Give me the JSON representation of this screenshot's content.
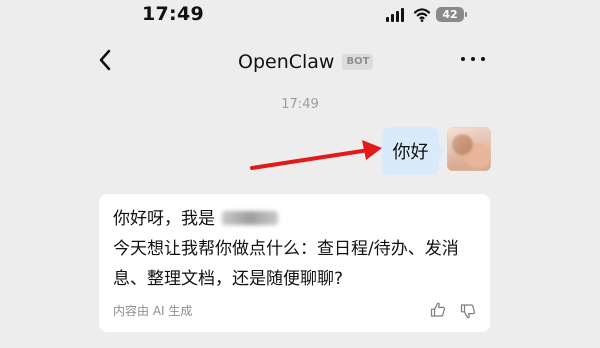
{
  "status": {
    "time": "17:49",
    "battery": "42"
  },
  "header": {
    "title": "OpenClaw",
    "badge": "BOT"
  },
  "conversation": {
    "timestamp": "17:49",
    "outgoing_message": "你好",
    "incoming": {
      "line1_prefix": "你好呀，我是",
      "line2": "今天想让我帮你做点什么：查日程/待办、发消",
      "line3": "息、整理文档，还是随便聊聊?",
      "ai_note": "内容由 AI 生成"
    }
  },
  "colors": {
    "background": "#ededed",
    "outgoing_bubble": "#d9ebfb",
    "arrow": "#e21a1a"
  }
}
